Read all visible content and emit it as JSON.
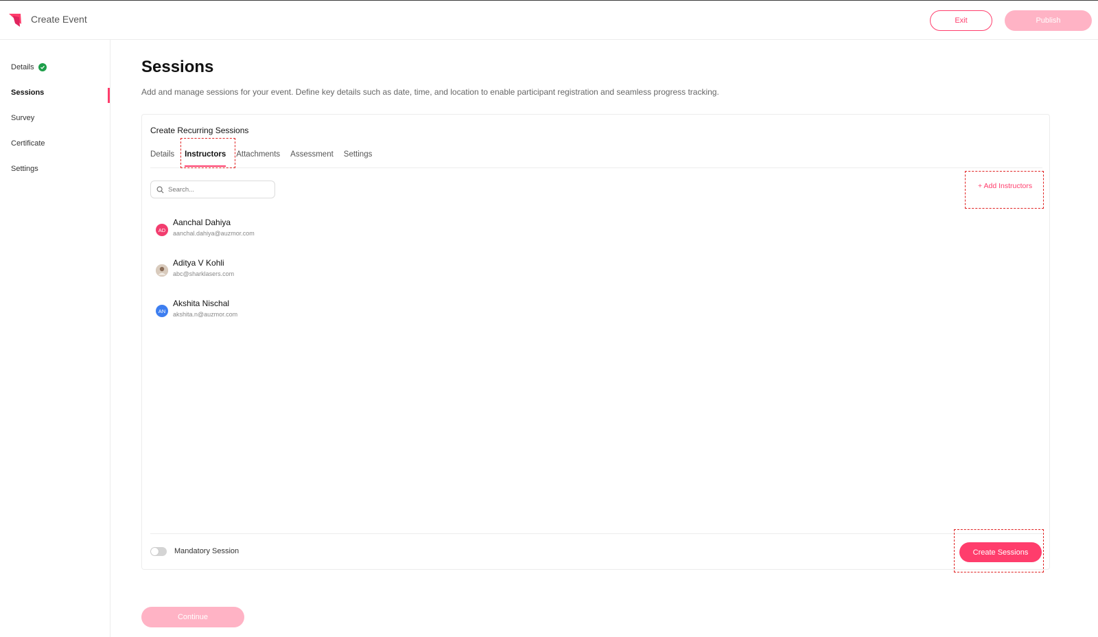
{
  "header": {
    "title": "Create Event",
    "exit_label": "Exit",
    "publish_label": "Publish"
  },
  "sidebar": {
    "items": [
      {
        "label": "Details"
      },
      {
        "label": "Sessions"
      },
      {
        "label": "Survey"
      },
      {
        "label": "Certificate"
      },
      {
        "label": "Settings"
      }
    ]
  },
  "main": {
    "title": "Sessions",
    "description": "Add and manage sessions for your event. Define key details such as date, time, and location to enable participant registration and seamless progress tracking."
  },
  "panel": {
    "title": "Create Recurring Sessions",
    "tabs": [
      {
        "label": "Details"
      },
      {
        "label": "Instructors"
      },
      {
        "label": "Attachments"
      },
      {
        "label": "Assessment"
      },
      {
        "label": "Settings"
      }
    ],
    "search_placeholder": "Search...",
    "add_instructors_label": "+ Add Instructors",
    "instructors": [
      {
        "initials": "AD",
        "name": "Aanchal Dahiya",
        "email": "aanchal.dahiya@auzmor.com",
        "avatar_color": "#f23d6f"
      },
      {
        "initials": "",
        "name": "Aditya V Kohli",
        "email": "abc@sharklasers.com",
        "avatar_color": "#c9b8a8"
      },
      {
        "initials": "AN",
        "name": "Akshita Nischal",
        "email": "akshita.n@auzmor.com",
        "avatar_color": "#3d7ef0"
      }
    ],
    "mandatory_label": "Mandatory Session",
    "mandatory_on": false,
    "create_label": "Create Sessions"
  },
  "footer": {
    "continue_label": "Continue"
  },
  "colors": {
    "accent": "#ff3d6c",
    "accent_light": "#ffb3c5",
    "success": "#1e9e4a"
  }
}
